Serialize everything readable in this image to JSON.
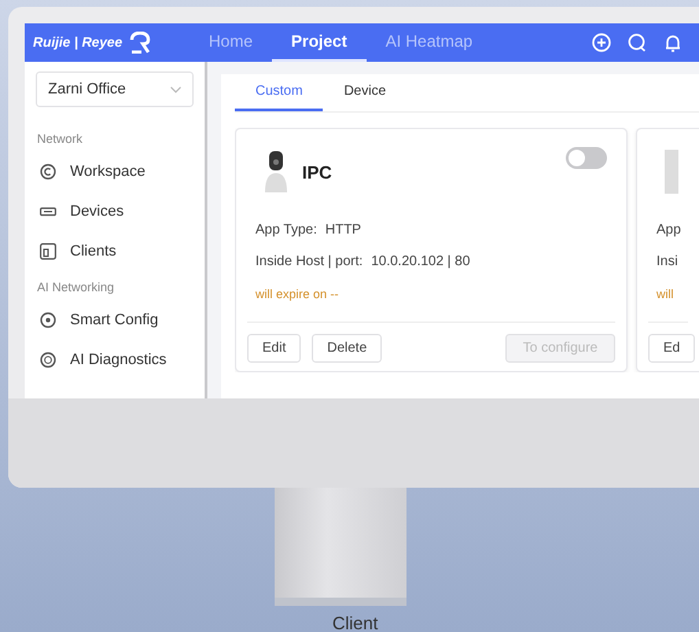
{
  "header": {
    "logo": "Ruijie | Reyee",
    "nav": [
      {
        "label": "Home",
        "selected": false
      },
      {
        "label": "Project",
        "selected": true
      },
      {
        "label": "AI Heatmap",
        "selected": false
      }
    ]
  },
  "sidebar": {
    "project": "Zarni Office",
    "sections": [
      {
        "title": "Network",
        "items": [
          {
            "label": "Workspace",
            "kind": "workspace"
          },
          {
            "label": "Devices",
            "kind": "devices"
          },
          {
            "label": "Clients",
            "kind": "clients"
          }
        ]
      },
      {
        "title": "AI Networking",
        "items": [
          {
            "label": "Smart Config",
            "kind": "smart"
          },
          {
            "label": "AI Diagnostics",
            "kind": "diagnostics"
          }
        ]
      }
    ]
  },
  "tabs": [
    {
      "label": "Custom",
      "selected": true
    },
    {
      "label": "Device",
      "selected": false
    }
  ],
  "cards": [
    {
      "name": "IPC",
      "enabled": false,
      "app_type_label": "App Type:",
      "app_type": "HTTP",
      "host_label": "Inside Host | port:",
      "host": "10.0.20.102 | 80",
      "expiry": "will expire on --",
      "buttons": [
        {
          "label": "Edit",
          "disabled": false
        },
        {
          "label": "Delete",
          "disabled": false
        },
        {
          "label": "To configure",
          "disabled": true
        }
      ]
    },
    {
      "app_type_label": "App",
      "host_label": "Insi",
      "expiry": "will",
      "buttons": [
        {
          "label": "Ed",
          "disabled": false
        }
      ]
    }
  ],
  "caption": "Client"
}
